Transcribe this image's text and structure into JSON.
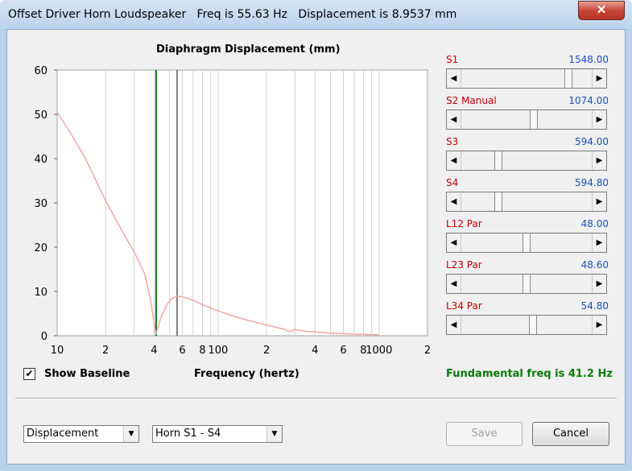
{
  "window": {
    "title": "Offset Driver Horn Loudspeaker   Freq is 55.63 Hz   Displacement is 8.9537 mm",
    "close_label": "✕"
  },
  "plot": {
    "title": "Diaphragm Displacement (mm)",
    "xlabel": "Frequency (hertz)"
  },
  "chart_data": {
    "type": "line",
    "title": "Diaphragm Displacement (mm)",
    "xlabel": "Frequency (hertz)",
    "ylabel": "",
    "x_scale": "log",
    "xlim": [
      10,
      2000
    ],
    "ylim": [
      0,
      60
    ],
    "grid": true,
    "y_ticks": [
      "60",
      "50",
      "40",
      "30",
      "20",
      "10",
      "0"
    ],
    "x_ticks": [
      "10",
      "2",
      "4",
      "6",
      "8",
      "100",
      "2",
      "4",
      "6",
      "8",
      "1000",
      "2"
    ],
    "fundamental_marker_hz": 41.2,
    "cursor_marker_hz": 55.63,
    "colors": {
      "curve": "#f4a6a6",
      "fundamental_line": "#0a7a0a",
      "cursor_line": "#000000",
      "grid": "#d0d0d0"
    },
    "series": [
      {
        "x": [
          10,
          12,
          15,
          20,
          25,
          30,
          35,
          38,
          40,
          41,
          42,
          44,
          48,
          52,
          55.6,
          60,
          70,
          80,
          100,
          130,
          160,
          200,
          250,
          280,
          300,
          350,
          400,
          500,
          700,
          1000
        ],
        "values": [
          50.5,
          46,
          40,
          30.5,
          24,
          19,
          14,
          8,
          3,
          0.3,
          1.5,
          4,
          7,
          8.5,
          8.95,
          8.8,
          8,
          7,
          5.6,
          4.2,
          3.3,
          2.4,
          1.6,
          0.9,
          1.4,
          1.0,
          0.9,
          0.6,
          0.35,
          0.2
        ]
      }
    ]
  },
  "sliders": [
    {
      "label": "S1",
      "value": "1548.00",
      "position": 0.84
    },
    {
      "label": "S2  Manual",
      "value": "1074.00",
      "position": 0.56
    },
    {
      "label": "S3",
      "value": "594.00",
      "position": 0.27
    },
    {
      "label": "S4",
      "value": "594.80",
      "position": 0.27
    },
    {
      "label": "L12  Par",
      "value": "48.00",
      "position": 0.5
    },
    {
      "label": "L23  Par",
      "value": "48.60",
      "position": 0.5
    },
    {
      "label": "L34  Par",
      "value": "54.80",
      "position": 0.55
    }
  ],
  "controls": {
    "show_baseline_label": "Show Baseline",
    "show_baseline_checked": "✔",
    "fundamental_text": "Fundamental freq is 41.2 Hz",
    "mode_select": "Displacement",
    "horn_select": "Horn S1 - S4",
    "save_label": "Save",
    "cancel_label": "Cancel",
    "dropdown_arrow": "▼",
    "arrow_left": "◀",
    "arrow_right": "▶"
  }
}
